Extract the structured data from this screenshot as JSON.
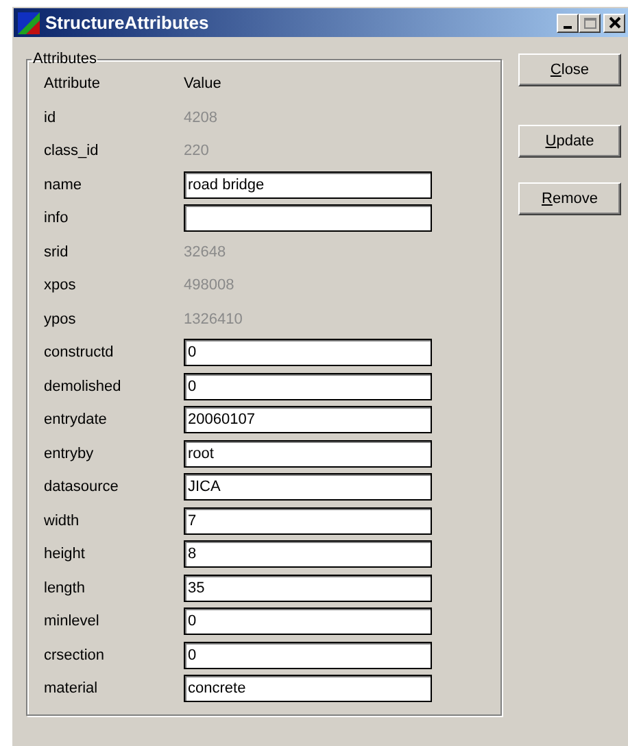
{
  "window": {
    "title": "StructureAttributes",
    "controls": [
      {
        "kind": "minimize",
        "disabled": false
      },
      {
        "kind": "maximize",
        "disabled": true
      },
      {
        "kind": "close",
        "disabled": false
      }
    ]
  },
  "group": {
    "label": "Attributes",
    "columns": [
      "Attribute",
      "Value"
    ],
    "rows": [
      {
        "label": "id",
        "kind": "readonly",
        "value": "4208"
      },
      {
        "label": "class_id",
        "kind": "readonly",
        "value": "220"
      },
      {
        "label": "name",
        "kind": "field",
        "value": "road bridge"
      },
      {
        "label": "info",
        "kind": "field"
      },
      {
        "label": "srid",
        "kind": "readonly",
        "value": "32648"
      },
      {
        "label": "xpos",
        "kind": "readonly",
        "value": "498008"
      },
      {
        "label": "ypos",
        "kind": "readonly",
        "value": "1326410"
      },
      {
        "label": "constructd",
        "kind": "field",
        "value": "0"
      },
      {
        "label": "demolished",
        "kind": "field",
        "value": "0"
      },
      {
        "label": "entrydate",
        "kind": "field",
        "value": "20060107"
      },
      {
        "label": "entryby",
        "kind": "field",
        "value": "root"
      },
      {
        "label": "datasource",
        "kind": "field",
        "value": "JICA"
      },
      {
        "label": "width",
        "kind": "field",
        "value": "7"
      },
      {
        "label": "height",
        "kind": "field",
        "value": "8"
      },
      {
        "label": "length",
        "kind": "field",
        "value": "35"
      },
      {
        "label": "minlevel",
        "kind": "field",
        "value": "0"
      },
      {
        "label": "crsection",
        "kind": "field",
        "value": "0"
      },
      {
        "label": "material",
        "kind": "field",
        "value": "concrete"
      }
    ]
  },
  "buttons": [
    {
      "access_key": "C",
      "label_rest": "lose"
    },
    {
      "access_key": "U",
      "label_rest": "pdate"
    },
    {
      "access_key": "R",
      "label_rest": "emove"
    }
  ]
}
